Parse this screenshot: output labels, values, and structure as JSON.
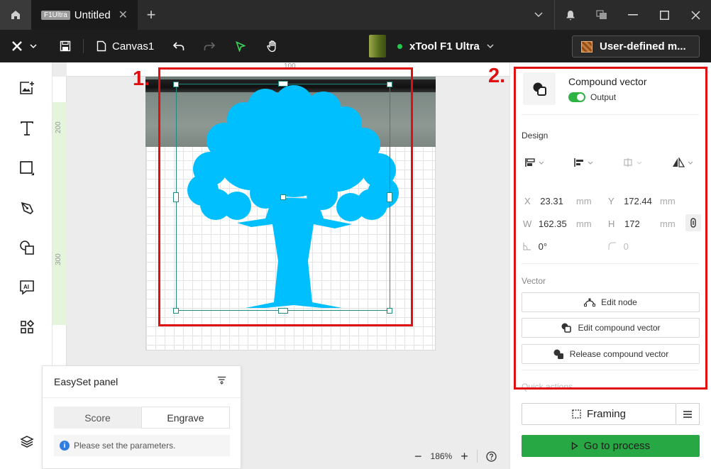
{
  "titlebar": {
    "tab_badge": "F1Ultra",
    "tab_title": "Untitled"
  },
  "toolbar": {
    "canvas_name": "Canvas1",
    "device_name": "xTool F1 Ultra",
    "device_status_color": "#28c84c",
    "material_label": "User-defined m..."
  },
  "left_tools": [
    "image-icon",
    "text-icon",
    "shape-icon",
    "pen-icon",
    "shapes-icon",
    "ai-icon",
    "apps-icon",
    "layers-icon"
  ],
  "canvas": {
    "ruler_top_mark": "100",
    "ruler_left_marks": [
      "200",
      "300"
    ],
    "selected_color": "#00bfff",
    "zoom": "186%"
  },
  "easyset": {
    "title": "EasySet panel",
    "tabs": [
      "Score",
      "Engrave"
    ],
    "active_tab": "Engrave",
    "message": "Please set the parameters."
  },
  "properties": {
    "object_title": "Compound vector",
    "output_label": "Output",
    "design_title": "Design",
    "x_label": "X",
    "x_value": "23.31",
    "x_unit": "mm",
    "y_label": "Y",
    "y_value": "172.44",
    "y_unit": "mm",
    "w_label": "W",
    "w_value": "162.35",
    "w_unit": "mm",
    "h_label": "H",
    "h_value": "172",
    "h_unit": "mm",
    "rotation_value": "0°",
    "corner_value": "0",
    "vector_title": "Vector",
    "edit_node": "Edit node",
    "edit_compound": "Edit compound vector",
    "release_compound": "Release compound vector",
    "quick_actions": "Quick actions"
  },
  "actions": {
    "framing": "Framing",
    "go_to_process": "Go to process"
  },
  "annotations": {
    "label1": "1.",
    "label2": "2.",
    "color": "#e01010"
  }
}
